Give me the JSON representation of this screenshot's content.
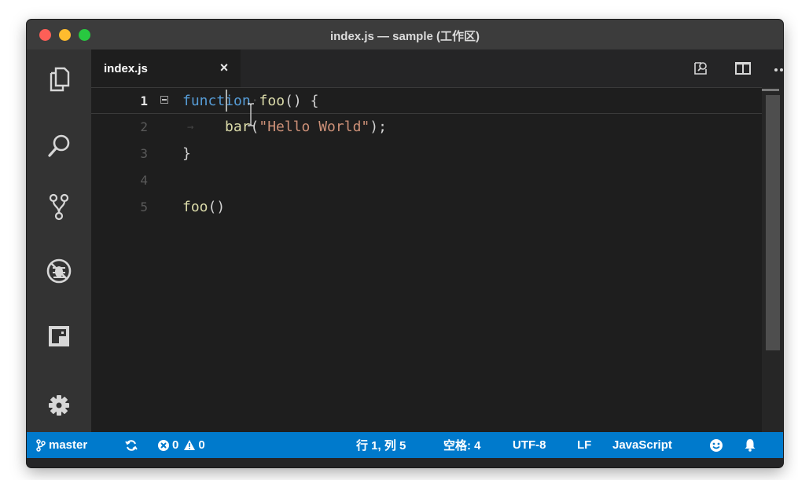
{
  "window": {
    "title": "index.js — sample (工作区)"
  },
  "tabs": [
    {
      "label": "index.js",
      "close_label": "×"
    }
  ],
  "editor": {
    "lines": [
      {
        "number": "1"
      },
      {
        "number": "2"
      },
      {
        "number": "3"
      },
      {
        "number": "4"
      },
      {
        "number": "5"
      }
    ],
    "code": {
      "line1_keyword": "function",
      "line1_name": "foo",
      "line1_rest": "() {",
      "line2_call": "bar",
      "line2_open": "(",
      "line2_string": "\"Hello World\"",
      "line2_close": ");",
      "line3": "}",
      "line5_call": "foo",
      "line5_rest": "()"
    }
  },
  "statusbar": {
    "branch": "master",
    "errors": "0",
    "warnings": "0",
    "position": "行 1, 列 5",
    "indent": "空格: 4",
    "encoding": "UTF-8",
    "eol": "LF",
    "language": "JavaScript"
  },
  "icons": {
    "activity": [
      "explorer-icon",
      "search-icon",
      "source-control-icon",
      "debug-icon",
      "extensions-icon",
      "settings-gear-icon"
    ],
    "tab_actions": [
      "open-preview-icon",
      "split-editor-icon",
      "more-actions-icon"
    ]
  },
  "colors": {
    "statusbar": "#007acc",
    "keyword": "#569cd6",
    "function": "#dcdcaa",
    "string": "#ce9178",
    "editor_bg": "#1e1e1e"
  }
}
